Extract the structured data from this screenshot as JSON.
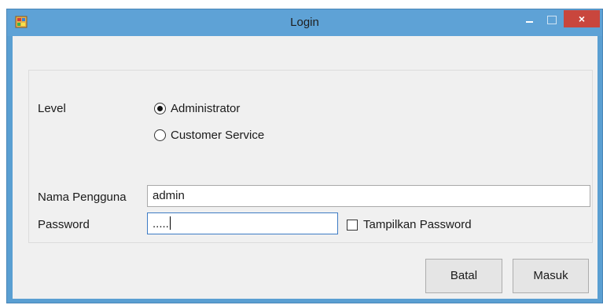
{
  "window": {
    "title": "Login",
    "close_glyph": "×",
    "accent_color": "#5ea2d6",
    "close_color": "#c9463d"
  },
  "form": {
    "level_label": "Level",
    "level_options": [
      {
        "label": "Administrator",
        "selected": true
      },
      {
        "label": "Customer Service",
        "selected": false
      }
    ],
    "username_label": "Nama Pengguna",
    "username_value": "admin",
    "password_label": "Password",
    "password_value": ".....",
    "show_password_label": "Tampilkan Password",
    "show_password_checked": false
  },
  "buttons": {
    "cancel_label": "Batal",
    "login_label": "Masuk"
  }
}
